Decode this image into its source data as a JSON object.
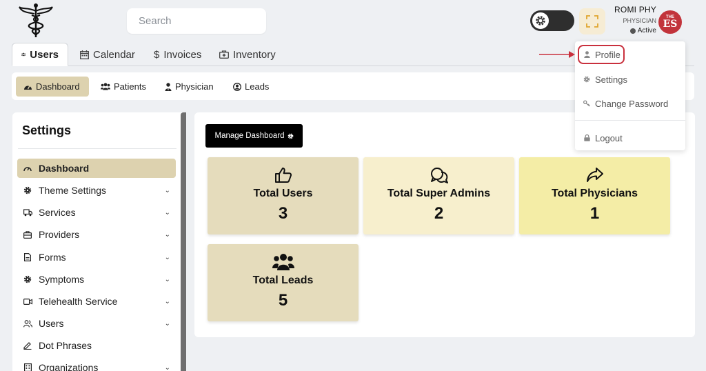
{
  "header": {
    "search_placeholder": "Search",
    "user_name": "ROMI PHY",
    "user_role": "PHYSICIAN",
    "user_status": "Active",
    "avatar_top": "THE",
    "avatar_main": "ES",
    "theme_toggle_state": "dark",
    "avatar_color": "#c2343b"
  },
  "main_tabs": [
    {
      "label": "Users",
      "icon": "users-icon",
      "active": true
    },
    {
      "label": "Calendar",
      "icon": "calendar-icon",
      "active": false
    },
    {
      "label": "Invoices",
      "icon": "dollar-icon",
      "active": false
    },
    {
      "label": "Inventory",
      "icon": "medkit-icon",
      "active": false
    }
  ],
  "sub_tabs": [
    {
      "label": "Dashboard",
      "icon": "gauge-icon",
      "active": true
    },
    {
      "label": "Patients",
      "icon": "users-icon",
      "active": false
    },
    {
      "label": "Physician",
      "icon": "doctor-icon",
      "active": false
    },
    {
      "label": "Leads",
      "icon": "user-circle-icon",
      "active": false
    }
  ],
  "settings": {
    "title": "Settings",
    "items": [
      {
        "label": "Dashboard",
        "icon": "gauge-icon",
        "active": true,
        "expandable": false
      },
      {
        "label": "Theme Settings",
        "icon": "gear-icon",
        "active": false,
        "expandable": true
      },
      {
        "label": "Services",
        "icon": "truck-icon",
        "active": false,
        "expandable": true
      },
      {
        "label": "Providers",
        "icon": "briefcase-icon",
        "active": false,
        "expandable": true
      },
      {
        "label": "Forms",
        "icon": "file-icon",
        "active": false,
        "expandable": true
      },
      {
        "label": "Symptoms",
        "icon": "gear-icon",
        "active": false,
        "expandable": true
      },
      {
        "label": "Telehealth Service",
        "icon": "video-icon",
        "active": false,
        "expandable": true
      },
      {
        "label": "Users",
        "icon": "users-outline-icon",
        "active": false,
        "expandable": true
      },
      {
        "label": "Dot Phrases",
        "icon": "pen-icon",
        "active": false,
        "expandable": false
      },
      {
        "label": "Organizations",
        "icon": "building-icon",
        "active": false,
        "expandable": true
      }
    ]
  },
  "dashboard": {
    "manage_label": "Manage Dashboard",
    "cards": [
      {
        "label": "Total Users",
        "value": "3",
        "icon": "thumbs-up-icon",
        "color": "#e5dcbc"
      },
      {
        "label": "Total Super Admins",
        "value": "2",
        "icon": "chat-bubbles-icon",
        "color": "#f7efcd"
      },
      {
        "label": "Total Physicians",
        "value": "1",
        "icon": "share-arrow-icon",
        "color": "#f4eda6"
      },
      {
        "label": "Total Leads",
        "value": "5",
        "icon": "users-group-icon",
        "color": "#e5dcbc"
      }
    ]
  },
  "profile_menu": {
    "items": [
      {
        "label": "Profile",
        "icon": "user-icon",
        "highlighted": true
      },
      {
        "label": "Settings",
        "icon": "gear-icon",
        "highlighted": false
      },
      {
        "label": "Change Password",
        "icon": "key-icon",
        "highlighted": false
      },
      {
        "label": "Logout",
        "icon": "lock-icon",
        "highlighted": false
      }
    ],
    "highlight_color": "#c9303d"
  }
}
